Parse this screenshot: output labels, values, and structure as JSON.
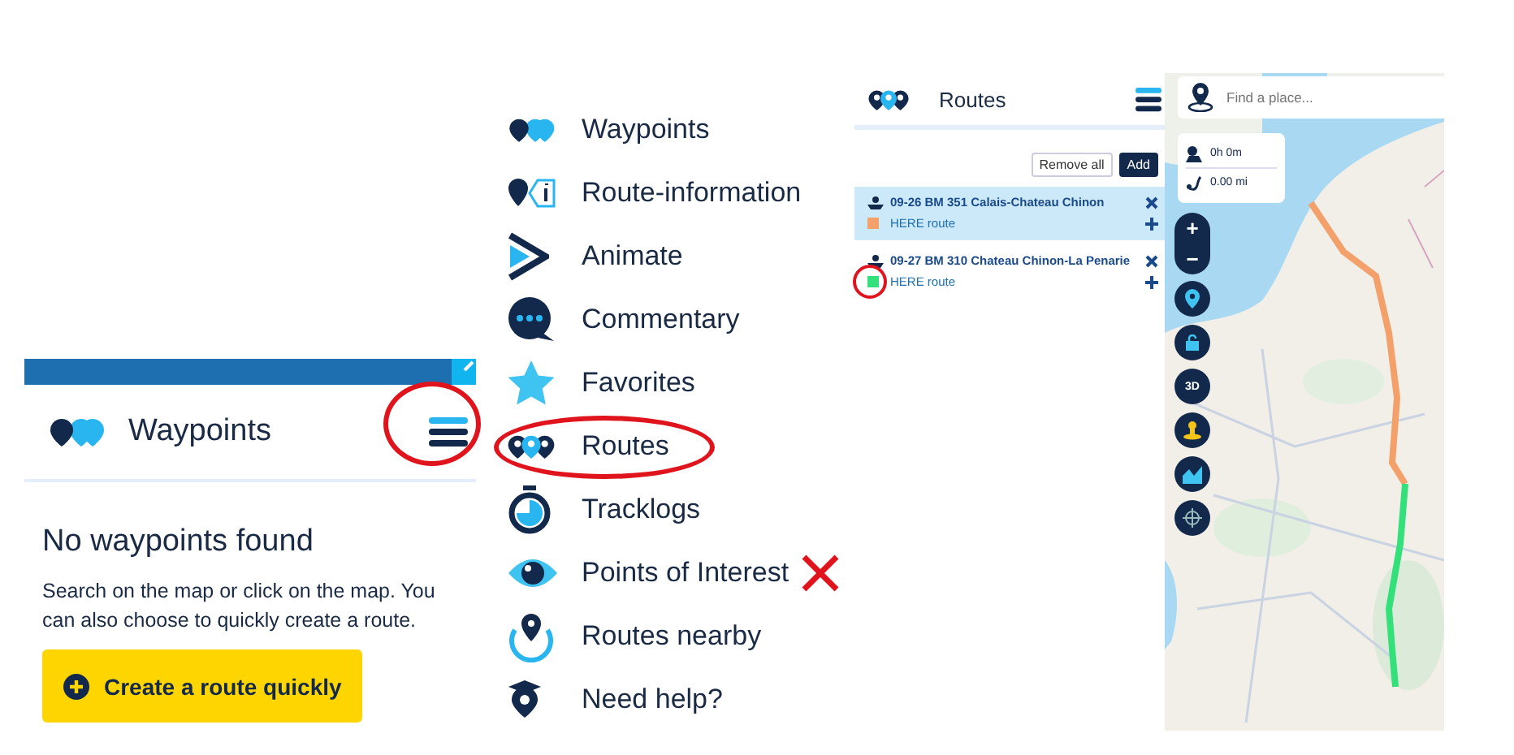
{
  "left_panel": {
    "title": "Waypoints",
    "menu_button_circled": true,
    "empty_heading": "No waypoints found",
    "empty_text": "Search on the map or click on the map. You can also choose to quickly create a route.",
    "button": "Create a route quickly"
  },
  "menu": {
    "items": [
      {
        "label": "Waypoints",
        "kind": "waypoints"
      },
      {
        "label": "Route-information",
        "kind": "info"
      },
      {
        "label": "Animate",
        "kind": "play"
      },
      {
        "label": "Commentary",
        "kind": "chat"
      },
      {
        "label": "Favorites",
        "kind": "star"
      },
      {
        "label": "Routes",
        "kind": "routes",
        "circled": true
      },
      {
        "label": "Tracklogs",
        "kind": "stopwatch"
      },
      {
        "label": "Points of Interest",
        "kind": "eye",
        "crossed": true
      },
      {
        "label": "Routes nearby",
        "kind": "nearby"
      },
      {
        "label": "Need help?",
        "kind": "help"
      }
    ]
  },
  "routes_panel": {
    "title": "Routes",
    "buttons": [
      {
        "label": "Remove all",
        "kind": "outline"
      },
      {
        "label": "Add",
        "kind": "solid"
      }
    ],
    "routes": [
      {
        "name": "09-26 BM 351 Calais-Chateau Chinon",
        "source": "HERE route",
        "color": "#f4a06a",
        "selected": true
      },
      {
        "name": "09-27 BM 310 Chateau Chinon-La Penarie",
        "source": "HERE route",
        "color": "#33e07a",
        "selected": false,
        "circled": true
      }
    ]
  },
  "map": {
    "search": {
      "placeholder": "Find a place..."
    },
    "duration": "0h 0m",
    "distance": "0.00 mi",
    "zoom_in": "+",
    "zoom_out": "−",
    "controls": [
      {
        "kind": "locate"
      },
      {
        "kind": "lock"
      },
      {
        "kind": "label",
        "label": "3D"
      },
      {
        "kind": "person"
      },
      {
        "kind": "chart"
      },
      {
        "kind": "target"
      }
    ]
  }
}
